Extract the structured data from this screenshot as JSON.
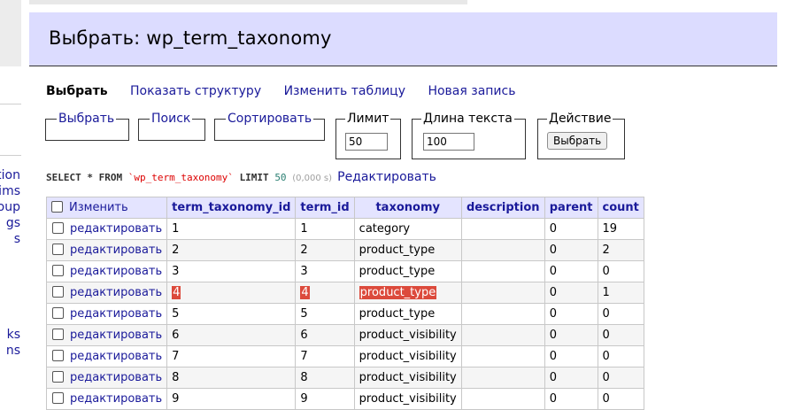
{
  "sidebar": {
    "items": [
      "tion",
      "aims",
      "oup",
      "gs",
      "s",
      "ks",
      "ns"
    ]
  },
  "header": {
    "title": "Выбрать: wp_term_taxonomy"
  },
  "menu": {
    "current": "Выбрать",
    "links": [
      "Показать структуру",
      "Изменить таблицу",
      "Новая запись"
    ]
  },
  "fieldsets": {
    "select": "Выбрать",
    "search": "Поиск",
    "sort": "Сортировать",
    "limit": {
      "legend": "Лимит",
      "value": "50"
    },
    "text_length": {
      "legend": "Длина текста",
      "value": "100"
    },
    "action": {
      "legend": "Действие",
      "button": "Выбрать"
    }
  },
  "sql": {
    "prefix": "SELECT * FROM",
    "table": "`wp_term_taxonomy`",
    "limit_kw": "LIMIT",
    "limit_val": "50",
    "time": "(0,000 s)",
    "edit": "Редактировать"
  },
  "table": {
    "select_all": "Изменить",
    "columns": [
      "term_taxonomy_id",
      "term_id",
      "taxonomy",
      "description",
      "parent",
      "count"
    ],
    "edit_label": "редактировать",
    "rows": [
      [
        "1",
        "1",
        "category",
        "",
        "0",
        "19"
      ],
      [
        "2",
        "2",
        "product_type",
        "",
        "0",
        "2"
      ],
      [
        "3",
        "3",
        "product_type",
        "",
        "0",
        "0"
      ],
      [
        "4",
        "4",
        "product_type",
        "",
        "0",
        "1"
      ],
      [
        "5",
        "5",
        "product_type",
        "",
        "0",
        "0"
      ],
      [
        "6",
        "6",
        "product_visibility",
        "",
        "0",
        "0"
      ],
      [
        "7",
        "7",
        "product_visibility",
        "",
        "0",
        "0"
      ],
      [
        "8",
        "8",
        "product_visibility",
        "",
        "0",
        "0"
      ],
      [
        "9",
        "9",
        "product_visibility",
        "",
        "0",
        "0"
      ]
    ],
    "highlight_row": 3,
    "highlight_cols": [
      0,
      1,
      2
    ]
  }
}
